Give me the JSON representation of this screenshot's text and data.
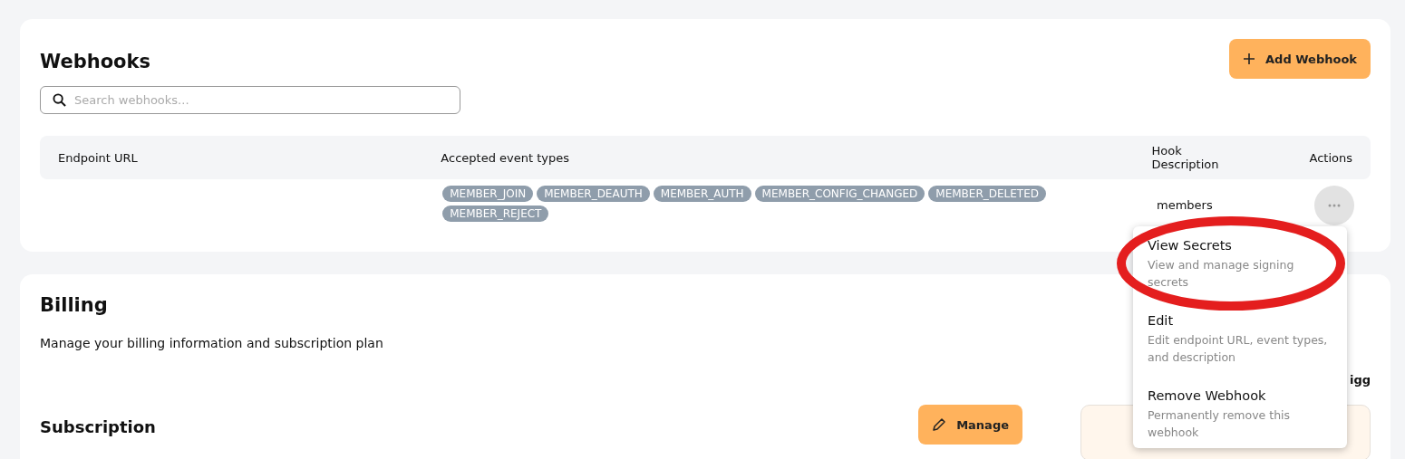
{
  "webhooks": {
    "title": "Webhooks",
    "add_button": "Add Webhook",
    "search": {
      "placeholder": "Search webhooks..."
    },
    "table": {
      "columns": [
        "Endpoint URL",
        "Accepted event types",
        "Hook Description",
        "Actions"
      ],
      "rows": [
        {
          "events": [
            "MEMBER_JOIN",
            "MEMBER_DEAUTH",
            "MEMBER_AUTH",
            "MEMBER_CONFIG_CHANGED",
            "MEMBER_DELETED",
            "MEMBER_REJECT"
          ],
          "description": "members"
        }
      ]
    },
    "menu": [
      {
        "label": "View Secrets",
        "description": "View and manage signing secrets"
      },
      {
        "label": "Edit",
        "description": "Edit endpoint URL, event types, and description"
      },
      {
        "label": "Remove Webhook",
        "description": "Permanently remove this webhook"
      }
    ]
  },
  "billing": {
    "title": "Billing",
    "subtitle": "Manage your billing information and subscription plan",
    "partial_text": "igg",
    "subscription_title": "Subscription",
    "manage_button": "Manage"
  }
}
